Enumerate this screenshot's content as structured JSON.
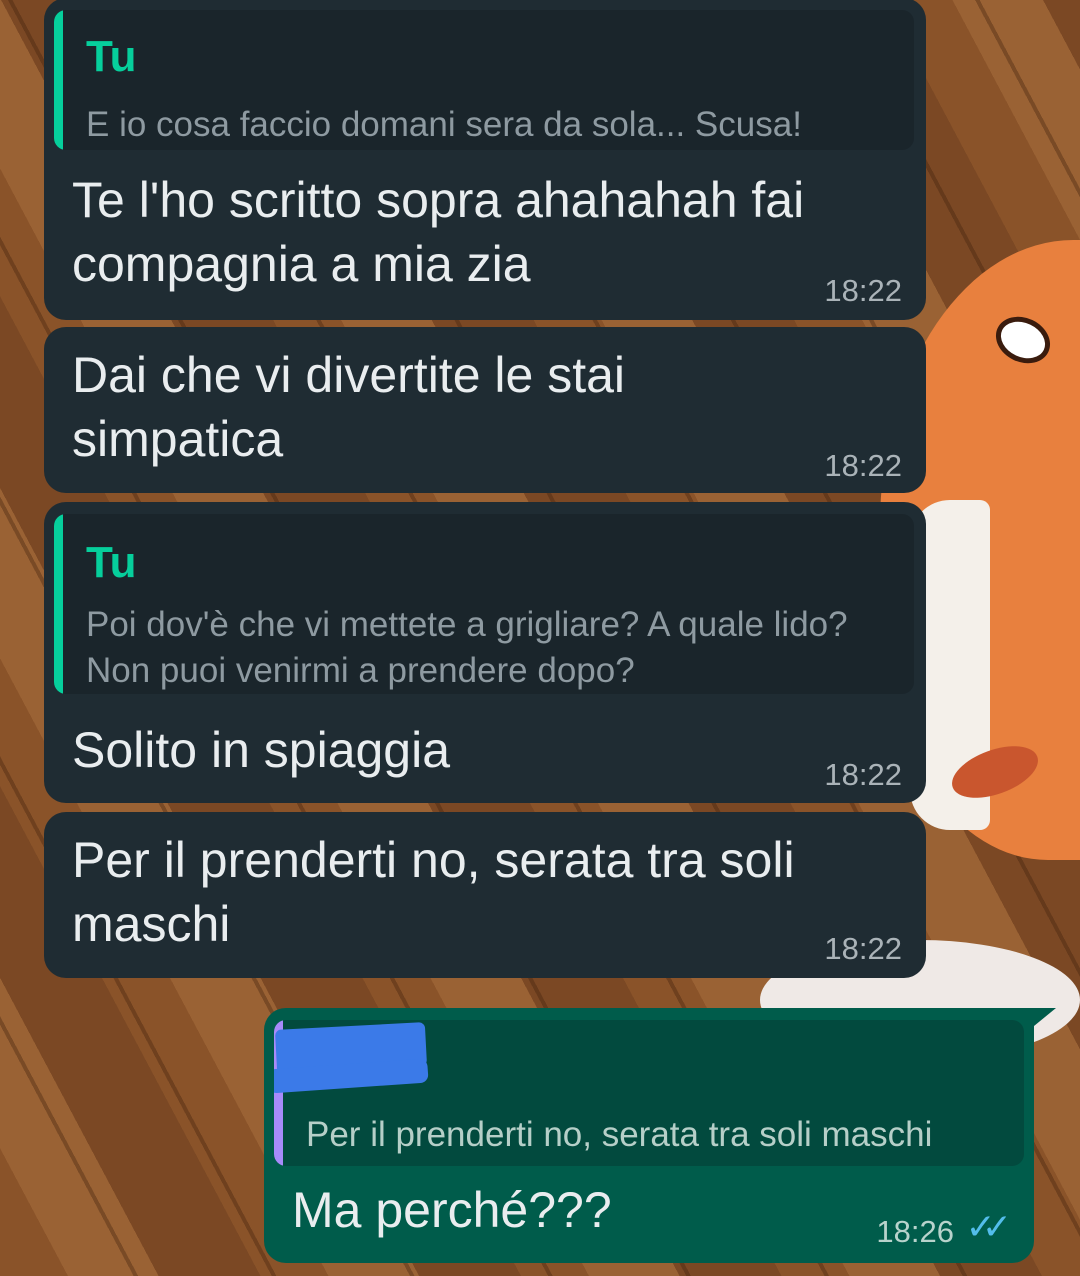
{
  "chat": {
    "messages": [
      {
        "direction": "incoming",
        "reply": {
          "author": "Tu",
          "text": "E io cosa faccio domani sera da sola... Scusa!"
        },
        "text": "Te l'ho scritto sopra ahahahah fai compagnia a mia zia",
        "time": "18:22"
      },
      {
        "direction": "incoming",
        "text": "Dai che vi divertite le stai simpatica",
        "time": "18:22"
      },
      {
        "direction": "incoming",
        "reply": {
          "author": "Tu",
          "text": "Poi dov'è che vi mettete a grigliare? A quale lido? Non puoi venirmi a prendere dopo?"
        },
        "text": "Solito in spiaggia",
        "time": "18:22"
      },
      {
        "direction": "incoming",
        "text": "Per il prenderti no, serata tra soli maschi",
        "time": "18:22"
      },
      {
        "direction": "outgoing",
        "reply": {
          "author": "",
          "author_redacted": true,
          "text": "Per il prenderti no, serata tra soli maschi"
        },
        "text": "Ma perché???",
        "time": "18:26",
        "status": "read",
        "status_icon": "double-check-icon"
      }
    ]
  },
  "colors": {
    "incoming_bubble": "#1f2c33",
    "outgoing_bubble": "#005c4b",
    "quote_author": "#06cf9c",
    "quote_bar_incoming": "#06cf9c",
    "quote_bar_outgoing": "#a78bfa",
    "read_ticks": "#53bdeb",
    "redaction": "#3b7ae8"
  }
}
